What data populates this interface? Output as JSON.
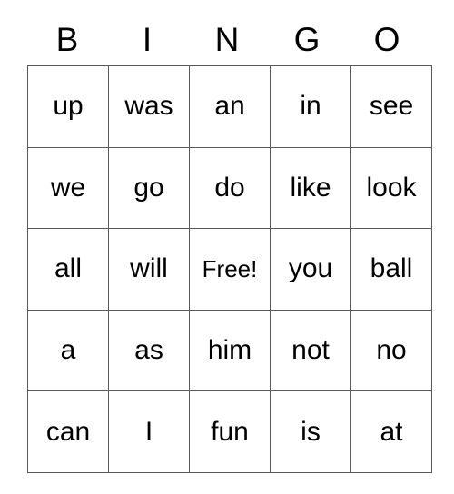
{
  "card": {
    "title": "BINGO",
    "header_letters": [
      "B",
      "I",
      "N",
      "G",
      "O"
    ],
    "free_space_label": "Free!",
    "free_space_position": {
      "row": 2,
      "col": 2
    },
    "grid_size": "5x5",
    "colors": {
      "background": "#ffffff",
      "text": "#000000",
      "grid_line": "#595959"
    },
    "rows": [
      {
        "cells": [
          {
            "text": "up",
            "free": false
          },
          {
            "text": "was",
            "free": false
          },
          {
            "text": "an",
            "free": false
          },
          {
            "text": "in",
            "free": false
          },
          {
            "text": "see",
            "free": false
          }
        ]
      },
      {
        "cells": [
          {
            "text": "we",
            "free": false
          },
          {
            "text": "go",
            "free": false
          },
          {
            "text": "do",
            "free": false
          },
          {
            "text": "like",
            "free": false
          },
          {
            "text": "look",
            "free": false
          }
        ]
      },
      {
        "cells": [
          {
            "text": "all",
            "free": false
          },
          {
            "text": "will",
            "free": false
          },
          {
            "text": "Free!",
            "free": true
          },
          {
            "text": "you",
            "free": false
          },
          {
            "text": "ball",
            "free": false
          }
        ]
      },
      {
        "cells": [
          {
            "text": "a",
            "free": false
          },
          {
            "text": "as",
            "free": false
          },
          {
            "text": "him",
            "free": false
          },
          {
            "text": "not",
            "free": false
          },
          {
            "text": "no",
            "free": false
          }
        ]
      },
      {
        "cells": [
          {
            "text": "can",
            "free": false
          },
          {
            "text": "I",
            "free": false
          },
          {
            "text": "fun",
            "free": false
          },
          {
            "text": "is",
            "free": false
          },
          {
            "text": "at",
            "free": false
          }
        ]
      }
    ]
  }
}
